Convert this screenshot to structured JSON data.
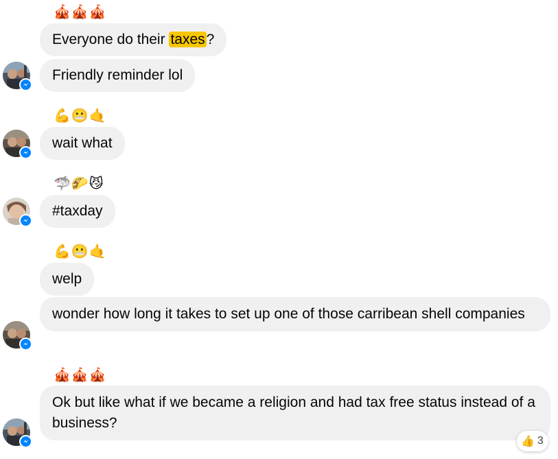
{
  "conversation": {
    "groups": [
      {
        "sender_emoji": "🎪🎪🎪",
        "messages": [
          {
            "before": "Everyone do their ",
            "highlight": "taxes",
            "after": "?"
          },
          {
            "text": "Friendly reminder lol"
          }
        ]
      },
      {
        "sender_emoji": "💪😬🤙",
        "messages": [
          {
            "text": "wait what"
          }
        ]
      },
      {
        "sender_emoji": "🦈🌮😼",
        "messages": [
          {
            "text": "#taxday"
          }
        ]
      },
      {
        "sender_emoji": "💪😬🤙",
        "messages": [
          {
            "text": "welp"
          },
          {
            "text": "wonder how long it takes to set up one of those carribean shell companies"
          }
        ]
      },
      {
        "sender_emoji": "🎪🎪🎪",
        "messages": [
          {
            "text": "Ok but like what if we became a religion and had tax free status instead of a business?"
          }
        ]
      }
    ],
    "reaction": {
      "emoji": "👍",
      "count": "3"
    }
  },
  "colors": {
    "bubble": "#f0f0f0",
    "highlight": "#f7c600",
    "messenger_badge": "#0084ff"
  },
  "icons": {
    "avatar_badge": "messenger-icon",
    "reaction": "thumbs-up-icon"
  }
}
